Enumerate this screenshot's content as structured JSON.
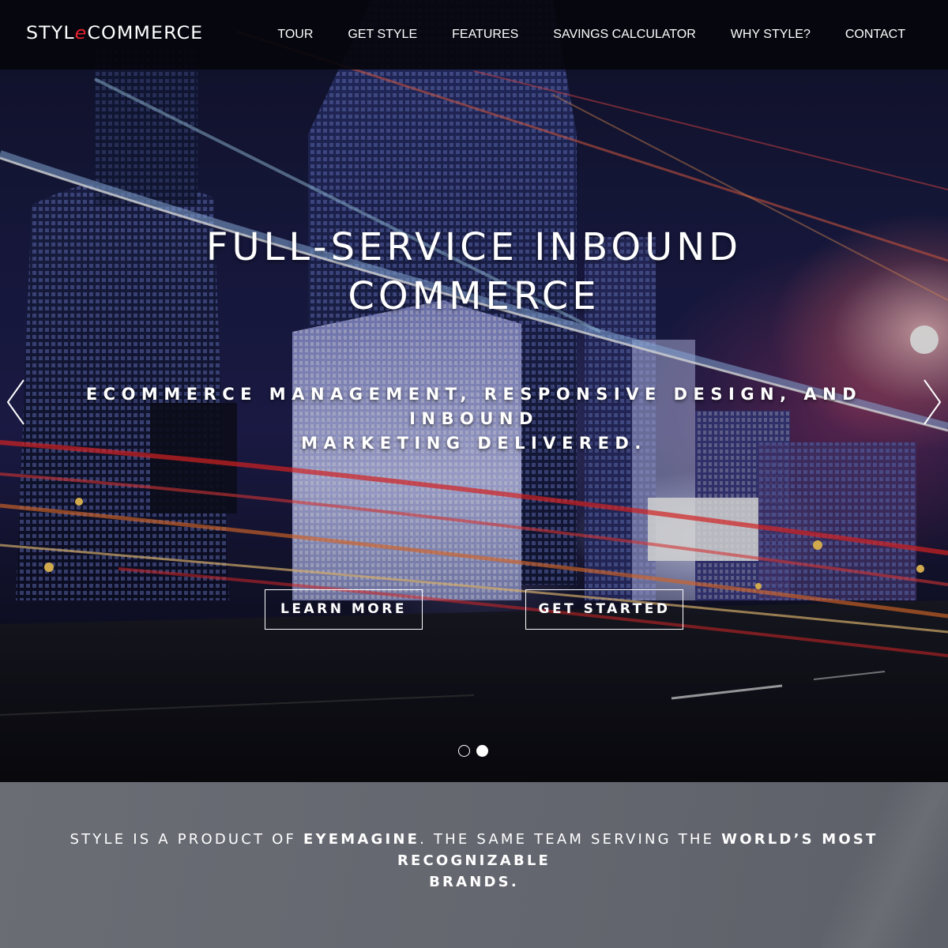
{
  "brand": {
    "logo_prefix": "STYL",
    "logo_accent": "e",
    "logo_suffix": "COMMERCE",
    "accent_color": "#e8232f"
  },
  "nav": {
    "items": [
      {
        "label": "TOUR"
      },
      {
        "label": "GET STYLE"
      },
      {
        "label": "FEATURES"
      },
      {
        "label": "SAVINGS CALCULATOR"
      },
      {
        "label": "WHY STYLE?"
      },
      {
        "label": "CONTACT"
      }
    ]
  },
  "hero": {
    "title_line1": "FULL-SERVICE INBOUND",
    "title_line2": "COMMERCE",
    "subtitle_line1": "ECOMMERCE MANAGEMENT, RESPONSIVE DESIGN, AND INBOUND",
    "subtitle_line2": "MARKETING DELIVERED.",
    "learn_more_label": "LEARN MORE",
    "get_started_label": "GET STARTED",
    "prev_icon": "chevron-left-icon",
    "next_icon": "chevron-right-icon",
    "slide_count": 2,
    "active_slide": 2
  },
  "band": {
    "part1": "STYLE IS A PRODUCT OF ",
    "part2": "EYEMAGINE",
    "part3": ". THE SAME TEAM SERVING THE ",
    "part4": "WORLD’S MOST RECOGNIZABLE",
    "part5": "BRANDS."
  }
}
